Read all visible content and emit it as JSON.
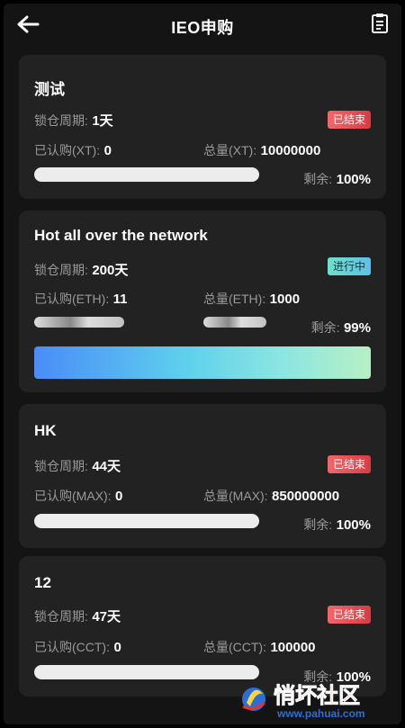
{
  "header": {
    "title": "IEO申购",
    "back_icon": "arrow-left-icon",
    "record_icon": "clipboard-icon"
  },
  "labels": {
    "lock_period": "锁仓周期:",
    "remaining": "剩余:"
  },
  "cards": [
    {
      "title": "测试",
      "lock_value": "1天",
      "status": "已结束",
      "subscribed_label": "已认购(XT):",
      "subscribed_value": "0",
      "total_label": "总量(XT):",
      "total_value": "10000000",
      "remaining_value": "100%"
    },
    {
      "title": "Hot all over the network",
      "lock_value": "200天",
      "status": "进行中",
      "subscribed_label": "已认购(ETH):",
      "subscribed_value": "11",
      "total_label": "总量(ETH):",
      "total_value": "1000",
      "remaining_value": "99%"
    },
    {
      "title": "HK",
      "lock_value": "44天",
      "status": "已结束",
      "subscribed_label": "已认购(MAX):",
      "subscribed_value": "0",
      "total_label": "总量(MAX):",
      "total_value": "850000000",
      "remaining_value": "100%"
    },
    {
      "title": "12",
      "lock_value": "47天",
      "status": "已结束",
      "subscribed_label": "已认购(CCT):",
      "subscribed_value": "0",
      "total_label": "总量(CCT):",
      "total_value": "100000",
      "remaining_value": "100%"
    }
  ],
  "watermark": {
    "name": "悄坏社区",
    "url": "www.pahuai.com"
  },
  "colors": {
    "background": "#141414",
    "card": "#222222",
    "ended_badge": "#e04a51",
    "ongoing_badge": "#6ed6d6",
    "button_gradient_start": "#4a8cf7",
    "button_gradient_end": "#b6f0c4"
  }
}
